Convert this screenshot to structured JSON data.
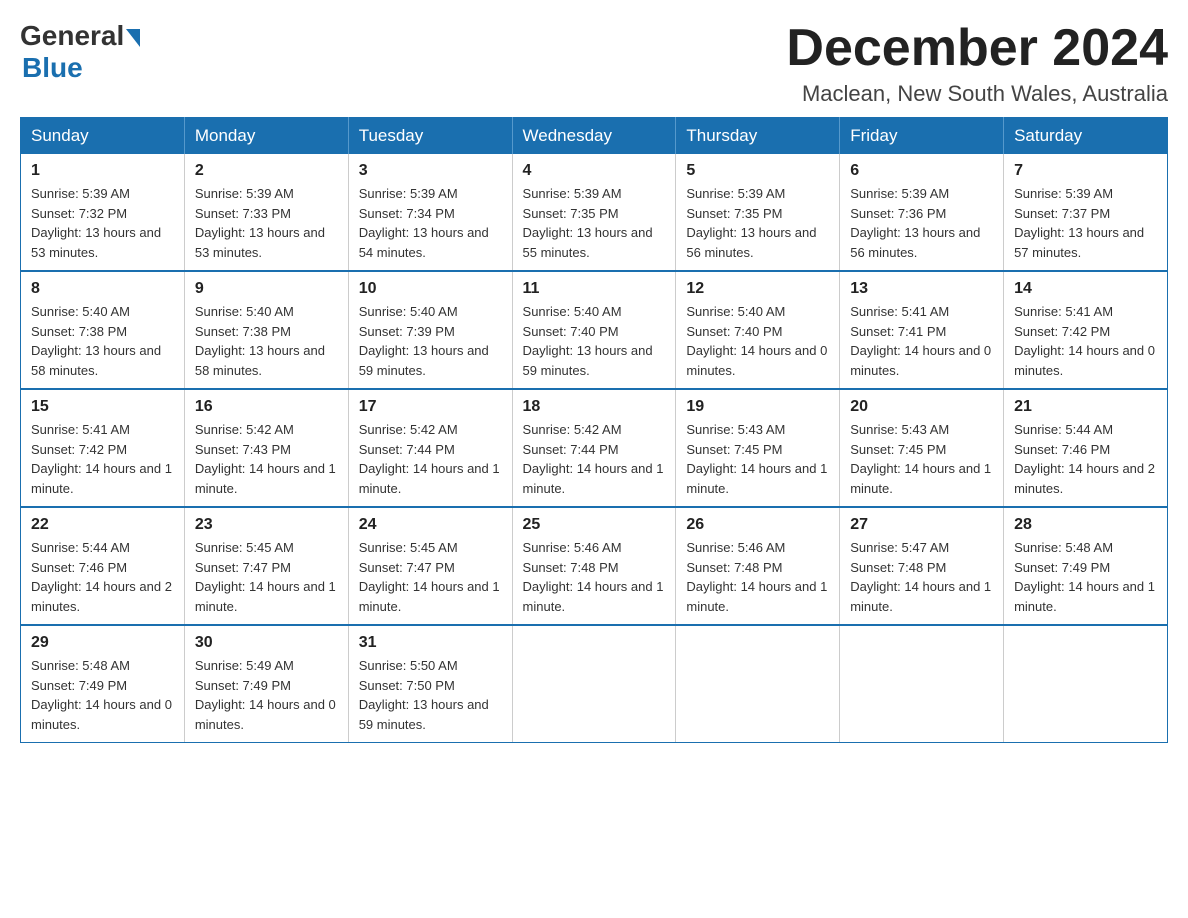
{
  "logo": {
    "general": "General",
    "blue": "Blue"
  },
  "title": {
    "month": "December 2024",
    "location": "Maclean, New South Wales, Australia"
  },
  "headers": [
    "Sunday",
    "Monday",
    "Tuesday",
    "Wednesday",
    "Thursday",
    "Friday",
    "Saturday"
  ],
  "weeks": [
    [
      {
        "day": "1",
        "sunrise": "5:39 AM",
        "sunset": "7:32 PM",
        "daylight": "13 hours and 53 minutes."
      },
      {
        "day": "2",
        "sunrise": "5:39 AM",
        "sunset": "7:33 PM",
        "daylight": "13 hours and 53 minutes."
      },
      {
        "day": "3",
        "sunrise": "5:39 AM",
        "sunset": "7:34 PM",
        "daylight": "13 hours and 54 minutes."
      },
      {
        "day": "4",
        "sunrise": "5:39 AM",
        "sunset": "7:35 PM",
        "daylight": "13 hours and 55 minutes."
      },
      {
        "day": "5",
        "sunrise": "5:39 AM",
        "sunset": "7:35 PM",
        "daylight": "13 hours and 56 minutes."
      },
      {
        "day": "6",
        "sunrise": "5:39 AM",
        "sunset": "7:36 PM",
        "daylight": "13 hours and 56 minutes."
      },
      {
        "day": "7",
        "sunrise": "5:39 AM",
        "sunset": "7:37 PM",
        "daylight": "13 hours and 57 minutes."
      }
    ],
    [
      {
        "day": "8",
        "sunrise": "5:40 AM",
        "sunset": "7:38 PM",
        "daylight": "13 hours and 58 minutes."
      },
      {
        "day": "9",
        "sunrise": "5:40 AM",
        "sunset": "7:38 PM",
        "daylight": "13 hours and 58 minutes."
      },
      {
        "day": "10",
        "sunrise": "5:40 AM",
        "sunset": "7:39 PM",
        "daylight": "13 hours and 59 minutes."
      },
      {
        "day": "11",
        "sunrise": "5:40 AM",
        "sunset": "7:40 PM",
        "daylight": "13 hours and 59 minutes."
      },
      {
        "day": "12",
        "sunrise": "5:40 AM",
        "sunset": "7:40 PM",
        "daylight": "14 hours and 0 minutes."
      },
      {
        "day": "13",
        "sunrise": "5:41 AM",
        "sunset": "7:41 PM",
        "daylight": "14 hours and 0 minutes."
      },
      {
        "day": "14",
        "sunrise": "5:41 AM",
        "sunset": "7:42 PM",
        "daylight": "14 hours and 0 minutes."
      }
    ],
    [
      {
        "day": "15",
        "sunrise": "5:41 AM",
        "sunset": "7:42 PM",
        "daylight": "14 hours and 1 minute."
      },
      {
        "day": "16",
        "sunrise": "5:42 AM",
        "sunset": "7:43 PM",
        "daylight": "14 hours and 1 minute."
      },
      {
        "day": "17",
        "sunrise": "5:42 AM",
        "sunset": "7:44 PM",
        "daylight": "14 hours and 1 minute."
      },
      {
        "day": "18",
        "sunrise": "5:42 AM",
        "sunset": "7:44 PM",
        "daylight": "14 hours and 1 minute."
      },
      {
        "day": "19",
        "sunrise": "5:43 AM",
        "sunset": "7:45 PM",
        "daylight": "14 hours and 1 minute."
      },
      {
        "day": "20",
        "sunrise": "5:43 AM",
        "sunset": "7:45 PM",
        "daylight": "14 hours and 1 minute."
      },
      {
        "day": "21",
        "sunrise": "5:44 AM",
        "sunset": "7:46 PM",
        "daylight": "14 hours and 2 minutes."
      }
    ],
    [
      {
        "day": "22",
        "sunrise": "5:44 AM",
        "sunset": "7:46 PM",
        "daylight": "14 hours and 2 minutes."
      },
      {
        "day": "23",
        "sunrise": "5:45 AM",
        "sunset": "7:47 PM",
        "daylight": "14 hours and 1 minute."
      },
      {
        "day": "24",
        "sunrise": "5:45 AM",
        "sunset": "7:47 PM",
        "daylight": "14 hours and 1 minute."
      },
      {
        "day": "25",
        "sunrise": "5:46 AM",
        "sunset": "7:48 PM",
        "daylight": "14 hours and 1 minute."
      },
      {
        "day": "26",
        "sunrise": "5:46 AM",
        "sunset": "7:48 PM",
        "daylight": "14 hours and 1 minute."
      },
      {
        "day": "27",
        "sunrise": "5:47 AM",
        "sunset": "7:48 PM",
        "daylight": "14 hours and 1 minute."
      },
      {
        "day": "28",
        "sunrise": "5:48 AM",
        "sunset": "7:49 PM",
        "daylight": "14 hours and 1 minute."
      }
    ],
    [
      {
        "day": "29",
        "sunrise": "5:48 AM",
        "sunset": "7:49 PM",
        "daylight": "14 hours and 0 minutes."
      },
      {
        "day": "30",
        "sunrise": "5:49 AM",
        "sunset": "7:49 PM",
        "daylight": "14 hours and 0 minutes."
      },
      {
        "day": "31",
        "sunrise": "5:50 AM",
        "sunset": "7:50 PM",
        "daylight": "13 hours and 59 minutes."
      },
      null,
      null,
      null,
      null
    ]
  ],
  "labels": {
    "sunrise": "Sunrise:",
    "sunset": "Sunset:",
    "daylight": "Daylight:"
  }
}
